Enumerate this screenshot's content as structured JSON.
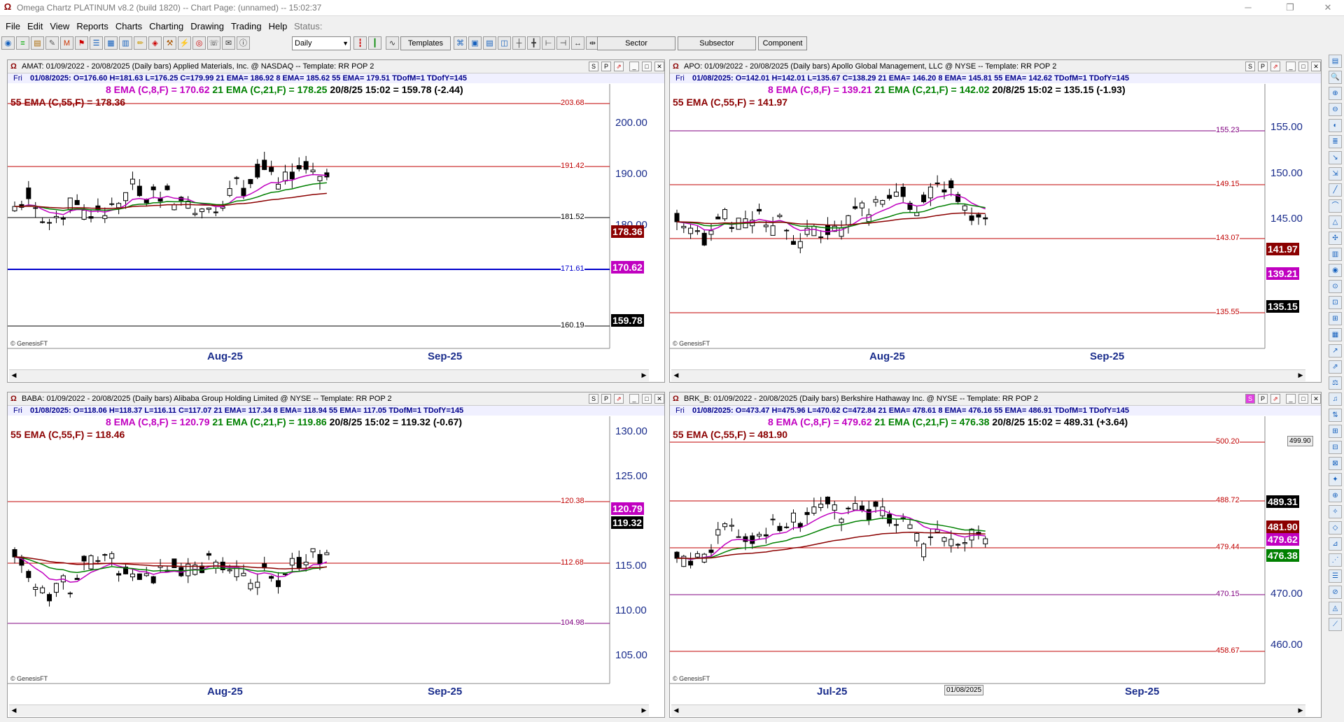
{
  "window": {
    "title": "Omega Chartz PLATINUM v8.2 (build 1820)  --  Chart Page: (unnamed)  --  15:02:37"
  },
  "menu": {
    "items": [
      "File",
      "Edit",
      "View",
      "Reports",
      "Charts",
      "Charting",
      "Drawing",
      "Trading",
      "Help"
    ],
    "status_label": "Status:"
  },
  "toolbar": {
    "period_value": "Daily",
    "templates_label": "Templates",
    "sector_label": "Sector",
    "subsector_label": "Subsector",
    "component_label": "Component"
  },
  "colors": {
    "magenta": "#c000c0",
    "green": "#008000",
    "darkred": "#8b0000",
    "axis_blue": "#1a2d8c"
  },
  "watermark": "© GenesisFT",
  "buttons": {
    "s": "S",
    "p": "P"
  },
  "panels": [
    {
      "id": "amat",
      "title": "AMAT:  01/09/2022 - 20/08/2025  (Daily bars)  Applied Materials, Inc. @ NASDAQ  --  Template: RR POP 2",
      "day": "Fri",
      "info": "01/08/2025:  O=176.60  H=181.63  L=176.25  C=179.99  21 EMA= 186.92  8 EMA= 185.62  55 EMA= 179.51  TDofM=1  TDofY=145",
      "ema8": "8 EMA (C,8,F) = 170.62",
      "ema21": "21 EMA (C,21,F) = 178.25",
      "last": "20/8/25 15:02 = 159.78 (-2.44)",
      "ema55": "55 EMA (C,55,F) = 178.36",
      "axis": [
        "200.00",
        "190.00",
        "180.00"
      ],
      "levels": [
        "203.68",
        "191.42",
        "181.52",
        "171.61",
        "160.19"
      ],
      "tags": [
        "178.36",
        "170.62",
        "159.78"
      ],
      "months": [
        "Aug-25",
        "Sep-25"
      ]
    },
    {
      "id": "apo",
      "title": "APO:  01/09/2022 - 20/08/2025  (Daily bars)  Apollo Global Management, LLC @ NYSE  --  Template: RR POP 2",
      "day": "Fri",
      "info": "01/08/2025:  O=142.01  H=142.01  L=135.67  C=138.29  21 EMA= 146.20  8 EMA= 145.81  55 EMA= 142.62  TDofM=1  TDofY=145",
      "ema8": "8 EMA (C,8,F) = 139.21",
      "ema21": "21 EMA (C,21,F) = 142.02",
      "last": "20/8/25 15:02 = 135.15 (-1.93)",
      "ema55": "55 EMA (C,55,F) = 141.97",
      "axis": [
        "155.00",
        "150.00",
        "145.00"
      ],
      "levels": [
        "155.23",
        "149.15",
        "143.07",
        "135.55"
      ],
      "tags": [
        "141.97",
        "139.21",
        "135.15"
      ],
      "months": [
        "Aug-25",
        "Sep-25"
      ]
    },
    {
      "id": "baba",
      "title": "BABA:  01/09/2022 - 20/08/2025  (Daily bars)  Alibaba Group Holding Limited @ NYSE  --  Template: RR POP 2",
      "day": "Fri",
      "info": "01/08/2025:  O=118.06  H=118.37  L=116.11  C=117.07  21 EMA= 117.34  8 EMA= 118.94  55 EMA= 117.05  TDofM=1  TDofY=145",
      "ema8": "8 EMA (C,8,F) = 120.79",
      "ema21": "21 EMA (C,21,F) = 119.86",
      "last": "20/8/25 15:02 = 119.32 (-0.67)",
      "ema55": "55 EMA (C,55,F) = 118.46",
      "axis": [
        "130.00",
        "125.00",
        "115.00",
        "110.00",
        "105.00"
      ],
      "levels": [
        "120.38",
        "112.68",
        "104.98"
      ],
      "tags": [
        "120.79",
        "119.32"
      ],
      "months": [
        "Aug-25",
        "Sep-25"
      ]
    },
    {
      "id": "brk",
      "title": "BRK_B:  01/09/2022 - 20/08/2025  (Daily bars)  Berkshire Hathaway Inc. @ NYSE  --  Template: RR POP 2",
      "day": "Fri",
      "info": "01/08/2025:  O=473.47  H=475.96  L=470.62  C=472.84  21 EMA= 478.61  8 EMA= 476.16  55 EMA= 486.91  TDofM=1  TDofY=145",
      "ema8": "8 EMA (C,8,F) = 479.62",
      "ema21": "21 EMA (C,21,F) = 476.38",
      "last": "20/8/25 15:02 = 489.31 (+3.64)",
      "ema55": "55 EMA (C,55,F) = 481.90",
      "axis": [
        "470.00",
        "460.00"
      ],
      "levels": [
        "500.20",
        "488.72",
        "479.44",
        "470.15",
        "458.67"
      ],
      "tags": [
        "489.31",
        "481.90",
        "479.62",
        "476.38"
      ],
      "small_tag": "499.90",
      "months": [
        "Jul-25",
        "Sep-25"
      ],
      "date_tooltip": "01/08/2025"
    }
  ]
}
